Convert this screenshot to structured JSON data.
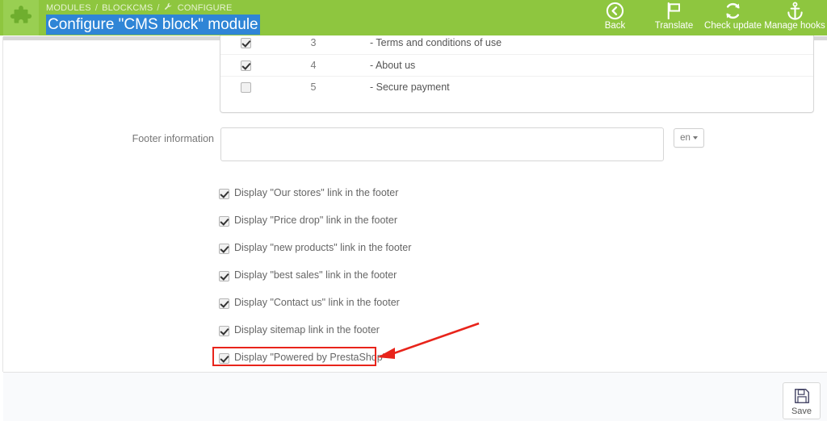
{
  "header": {
    "module_icon": "puzzle-piece-icon",
    "breadcrumb": {
      "level1": "MODULES",
      "sep1": "/",
      "level2": "BLOCKCMS",
      "sep2": "/",
      "level3": "CONFIGURE",
      "level3_icon": "wrench-icon"
    },
    "title": "Configure \"CMS block\" module",
    "title_selected": true,
    "selection_color": "#2f85d6",
    "background_color": "#8ec63f",
    "toolbar": [
      {
        "label": "Back",
        "icon": "back-arrow-circle-icon"
      },
      {
        "label": "Translate",
        "icon": "flag-icon"
      },
      {
        "label": "Check update",
        "icon": "refresh-sync-icon"
      },
      {
        "label": "Manage hooks",
        "icon": "anchor-icon"
      }
    ]
  },
  "cms_table": {
    "rows": [
      {
        "checked": true,
        "number": "3",
        "label": "- Terms and conditions of use"
      },
      {
        "checked": true,
        "number": "4",
        "label": "- About us"
      },
      {
        "checked": false,
        "number": "5",
        "label": "- Secure payment"
      }
    ]
  },
  "footer_information": {
    "label": "Footer information",
    "value": "",
    "placeholder": "",
    "language": "en"
  },
  "options": [
    {
      "checked": true,
      "label": "Display \"Our stores\" link in the footer"
    },
    {
      "checked": true,
      "label": "Display \"Price drop\" link in the footer"
    },
    {
      "checked": true,
      "label": "Display \"new products\" link in the footer"
    },
    {
      "checked": true,
      "label": "Display \"best sales\" link in the footer"
    },
    {
      "checked": true,
      "label": "Display \"Contact us\" link in the footer"
    },
    {
      "checked": true,
      "label": "Display sitemap link in the footer"
    },
    {
      "checked": true,
      "label": "Display \"Powered by PrestaShop\""
    }
  ],
  "annotation": {
    "highlight_color": "#e8241b",
    "target_option_index": 6
  },
  "panel_footer": {
    "save_label": "Save",
    "save_icon": "floppy-disk-save-icon"
  }
}
